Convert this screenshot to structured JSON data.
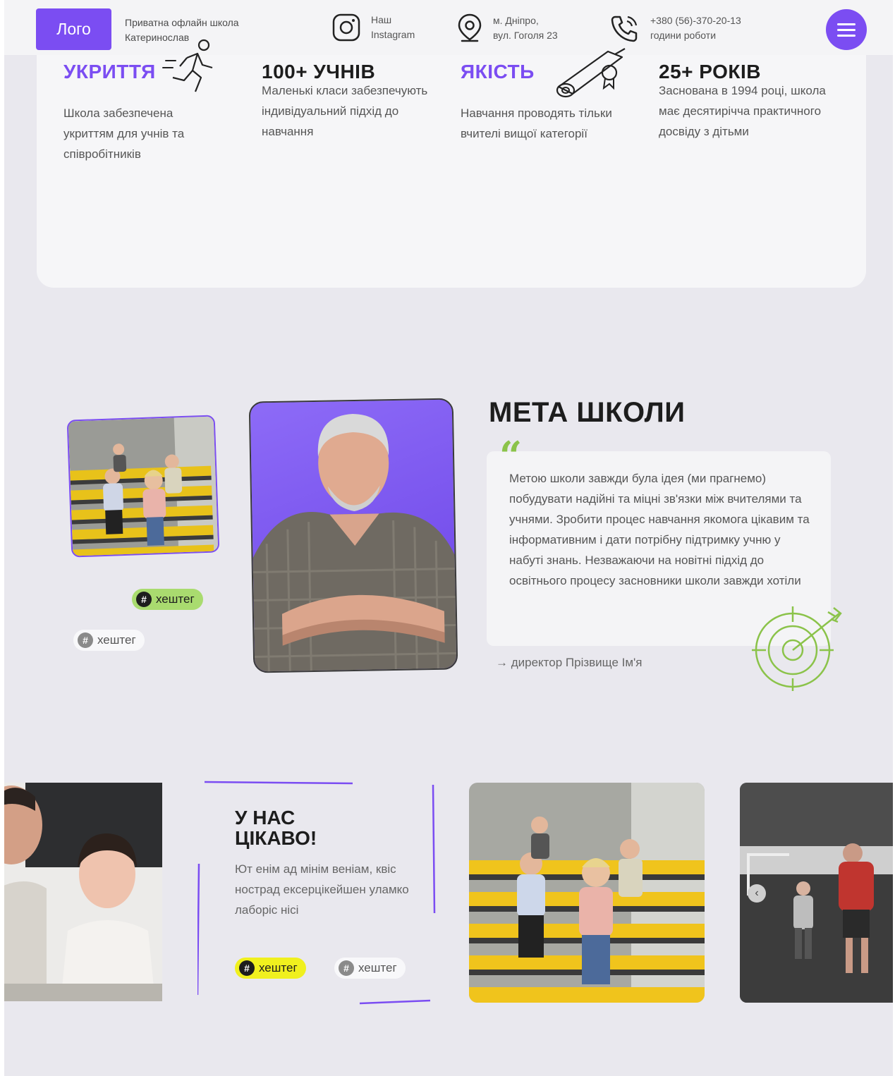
{
  "header": {
    "logo": "Лого",
    "school_line1": "Приватна офлайн школа",
    "school_line2": "Катеринослав",
    "instagram_line1": "Наш",
    "instagram_line2": "Instagram",
    "address_line1": "м. Дніпро,",
    "address_line2": "вул. Гоголя 23",
    "phone_line1": "+380 (56)-370-20-13",
    "phone_line2": "години роботи",
    "menu_icon": "hamburger-icon"
  },
  "features": [
    {
      "title": "УКРИТТЯ",
      "desc": "Школа забезпечена укриттям для учнів та співробітників",
      "icon": "running-man-icon"
    },
    {
      "title": "100+ УЧНІВ",
      "desc": "Маленькі класи забезпечують індивідуальний підхід до навчання"
    },
    {
      "title": "ЯКІСТЬ",
      "desc": "Навчання проводять тільки вчителі вищої категорії",
      "icon": "diploma-icon"
    },
    {
      "title": "25+ РОКІВ",
      "desc": "Заснована в 1994 році, школа має десятирічча практичного досвіду з дітьми"
    }
  ],
  "mission": {
    "title": "МЕТА ШКОЛИ",
    "quote": "Метою школи завжди була ідея (ми прагнемо) побудувати надійні та міцні зв'язки між вчителями та учнями. Зробити процес навчання якомога цікавим та інформативним і дати потрібну підтримку учню у набуті знань. Незважаючи на новітні підхід до освітнього процесу засновники школи завжди хотіли",
    "director": "→ директор Прізвище Ім'я",
    "tag1": "хештег",
    "tag2": "хештег"
  },
  "promo": {
    "title_line1": "У НАС",
    "title_line2": "ЦІКАВО!",
    "text": "Ют енім ад мінім веніам, квіс нострад ексерцікейшен уламко лаборіс нісі",
    "tag1": "хештег",
    "tag2": "хештег"
  },
  "colors": {
    "accent": "#7b4df2",
    "green": "#a9db6f",
    "yellow": "#f0f01e",
    "background": "#e9e8ee"
  }
}
